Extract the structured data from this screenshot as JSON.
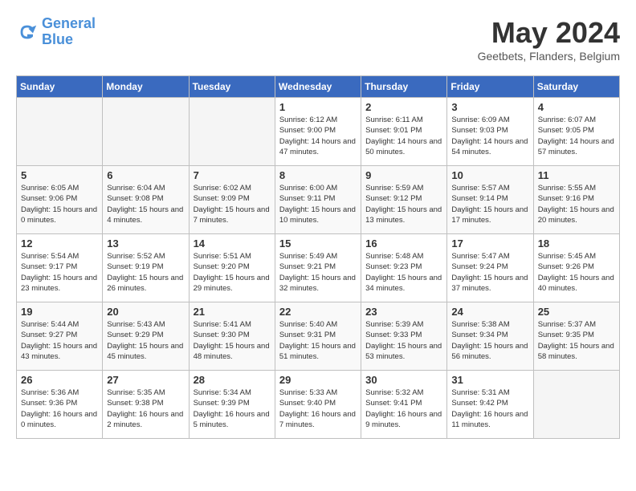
{
  "header": {
    "logo_line1": "General",
    "logo_line2": "Blue",
    "month_year": "May 2024",
    "location": "Geetbets, Flanders, Belgium"
  },
  "weekdays": [
    "Sunday",
    "Monday",
    "Tuesday",
    "Wednesday",
    "Thursday",
    "Friday",
    "Saturday"
  ],
  "weeks": [
    [
      {
        "day": "",
        "empty": true
      },
      {
        "day": "",
        "empty": true
      },
      {
        "day": "",
        "empty": true
      },
      {
        "day": "1",
        "sunrise": "6:12 AM",
        "sunset": "9:00 PM",
        "daylight": "14 hours and 47 minutes."
      },
      {
        "day": "2",
        "sunrise": "6:11 AM",
        "sunset": "9:01 PM",
        "daylight": "14 hours and 50 minutes."
      },
      {
        "day": "3",
        "sunrise": "6:09 AM",
        "sunset": "9:03 PM",
        "daylight": "14 hours and 54 minutes."
      },
      {
        "day": "4",
        "sunrise": "6:07 AM",
        "sunset": "9:05 PM",
        "daylight": "14 hours and 57 minutes."
      }
    ],
    [
      {
        "day": "5",
        "sunrise": "6:05 AM",
        "sunset": "9:06 PM",
        "daylight": "15 hours and 0 minutes."
      },
      {
        "day": "6",
        "sunrise": "6:04 AM",
        "sunset": "9:08 PM",
        "daylight": "15 hours and 4 minutes."
      },
      {
        "day": "7",
        "sunrise": "6:02 AM",
        "sunset": "9:09 PM",
        "daylight": "15 hours and 7 minutes."
      },
      {
        "day": "8",
        "sunrise": "6:00 AM",
        "sunset": "9:11 PM",
        "daylight": "15 hours and 10 minutes."
      },
      {
        "day": "9",
        "sunrise": "5:59 AM",
        "sunset": "9:12 PM",
        "daylight": "15 hours and 13 minutes."
      },
      {
        "day": "10",
        "sunrise": "5:57 AM",
        "sunset": "9:14 PM",
        "daylight": "15 hours and 17 minutes."
      },
      {
        "day": "11",
        "sunrise": "5:55 AM",
        "sunset": "9:16 PM",
        "daylight": "15 hours and 20 minutes."
      }
    ],
    [
      {
        "day": "12",
        "sunrise": "5:54 AM",
        "sunset": "9:17 PM",
        "daylight": "15 hours and 23 minutes."
      },
      {
        "day": "13",
        "sunrise": "5:52 AM",
        "sunset": "9:19 PM",
        "daylight": "15 hours and 26 minutes."
      },
      {
        "day": "14",
        "sunrise": "5:51 AM",
        "sunset": "9:20 PM",
        "daylight": "15 hours and 29 minutes."
      },
      {
        "day": "15",
        "sunrise": "5:49 AM",
        "sunset": "9:21 PM",
        "daylight": "15 hours and 32 minutes."
      },
      {
        "day": "16",
        "sunrise": "5:48 AM",
        "sunset": "9:23 PM",
        "daylight": "15 hours and 34 minutes."
      },
      {
        "day": "17",
        "sunrise": "5:47 AM",
        "sunset": "9:24 PM",
        "daylight": "15 hours and 37 minutes."
      },
      {
        "day": "18",
        "sunrise": "5:45 AM",
        "sunset": "9:26 PM",
        "daylight": "15 hours and 40 minutes."
      }
    ],
    [
      {
        "day": "19",
        "sunrise": "5:44 AM",
        "sunset": "9:27 PM",
        "daylight": "15 hours and 43 minutes."
      },
      {
        "day": "20",
        "sunrise": "5:43 AM",
        "sunset": "9:29 PM",
        "daylight": "15 hours and 45 minutes."
      },
      {
        "day": "21",
        "sunrise": "5:41 AM",
        "sunset": "9:30 PM",
        "daylight": "15 hours and 48 minutes."
      },
      {
        "day": "22",
        "sunrise": "5:40 AM",
        "sunset": "9:31 PM",
        "daylight": "15 hours and 51 minutes."
      },
      {
        "day": "23",
        "sunrise": "5:39 AM",
        "sunset": "9:33 PM",
        "daylight": "15 hours and 53 minutes."
      },
      {
        "day": "24",
        "sunrise": "5:38 AM",
        "sunset": "9:34 PM",
        "daylight": "15 hours and 56 minutes."
      },
      {
        "day": "25",
        "sunrise": "5:37 AM",
        "sunset": "9:35 PM",
        "daylight": "15 hours and 58 minutes."
      }
    ],
    [
      {
        "day": "26",
        "sunrise": "5:36 AM",
        "sunset": "9:36 PM",
        "daylight": "16 hours and 0 minutes."
      },
      {
        "day": "27",
        "sunrise": "5:35 AM",
        "sunset": "9:38 PM",
        "daylight": "16 hours and 2 minutes."
      },
      {
        "day": "28",
        "sunrise": "5:34 AM",
        "sunset": "9:39 PM",
        "daylight": "16 hours and 5 minutes."
      },
      {
        "day": "29",
        "sunrise": "5:33 AM",
        "sunset": "9:40 PM",
        "daylight": "16 hours and 7 minutes."
      },
      {
        "day": "30",
        "sunrise": "5:32 AM",
        "sunset": "9:41 PM",
        "daylight": "16 hours and 9 minutes."
      },
      {
        "day": "31",
        "sunrise": "5:31 AM",
        "sunset": "9:42 PM",
        "daylight": "16 hours and 11 minutes."
      },
      {
        "day": "",
        "empty": true
      }
    ]
  ]
}
